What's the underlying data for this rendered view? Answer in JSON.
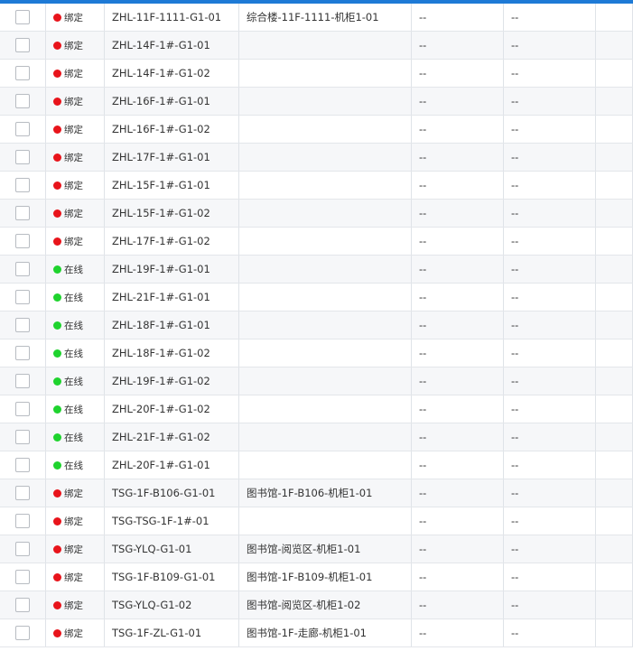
{
  "colors": {
    "bound": "#e8141b",
    "online": "#1fd32e",
    "accent": "#1e7ad6"
  },
  "rows": [
    {
      "status": "绑定",
      "state": "bound",
      "code": "ZHL-11F-1111-G1-01",
      "location": "综合楼-11F-1111-机柜1-01",
      "col_a": "--",
      "col_b": "--"
    },
    {
      "status": "绑定",
      "state": "bound",
      "code": "ZHL-14F-1#-G1-01",
      "location": "",
      "col_a": "--",
      "col_b": "--"
    },
    {
      "status": "绑定",
      "state": "bound",
      "code": "ZHL-14F-1#-G1-02",
      "location": "",
      "col_a": "--",
      "col_b": "--"
    },
    {
      "status": "绑定",
      "state": "bound",
      "code": "ZHL-16F-1#-G1-01",
      "location": "",
      "col_a": "--",
      "col_b": "--"
    },
    {
      "status": "绑定",
      "state": "bound",
      "code": "ZHL-16F-1#-G1-02",
      "location": "",
      "col_a": "--",
      "col_b": "--"
    },
    {
      "status": "绑定",
      "state": "bound",
      "code": "ZHL-17F-1#-G1-01",
      "location": "",
      "col_a": "--",
      "col_b": "--"
    },
    {
      "status": "绑定",
      "state": "bound",
      "code": "ZHL-15F-1#-G1-01",
      "location": "",
      "col_a": "--",
      "col_b": "--"
    },
    {
      "status": "绑定",
      "state": "bound",
      "code": "ZHL-15F-1#-G1-02",
      "location": "",
      "col_a": "--",
      "col_b": "--"
    },
    {
      "status": "绑定",
      "state": "bound",
      "code": "ZHL-17F-1#-G1-02",
      "location": "",
      "col_a": "--",
      "col_b": "--"
    },
    {
      "status": "在线",
      "state": "online",
      "code": "ZHL-19F-1#-G1-01",
      "location": "",
      "col_a": "--",
      "col_b": "--"
    },
    {
      "status": "在线",
      "state": "online",
      "code": "ZHL-21F-1#-G1-01",
      "location": "",
      "col_a": "--",
      "col_b": "--"
    },
    {
      "status": "在线",
      "state": "online",
      "code": "ZHL-18F-1#-G1-01",
      "location": "",
      "col_a": "--",
      "col_b": "--"
    },
    {
      "status": "在线",
      "state": "online",
      "code": "ZHL-18F-1#-G1-02",
      "location": "",
      "col_a": "--",
      "col_b": "--"
    },
    {
      "status": "在线",
      "state": "online",
      "code": "ZHL-19F-1#-G1-02",
      "location": "",
      "col_a": "--",
      "col_b": "--"
    },
    {
      "status": "在线",
      "state": "online",
      "code": "ZHL-20F-1#-G1-02",
      "location": "",
      "col_a": "--",
      "col_b": "--"
    },
    {
      "status": "在线",
      "state": "online",
      "code": "ZHL-21F-1#-G1-02",
      "location": "",
      "col_a": "--",
      "col_b": "--"
    },
    {
      "status": "在线",
      "state": "online",
      "code": "ZHL-20F-1#-G1-01",
      "location": "",
      "col_a": "--",
      "col_b": "--"
    },
    {
      "status": "绑定",
      "state": "bound",
      "code": "TSG-1F-B106-G1-01",
      "location": "图书馆-1F-B106-机柜1-01",
      "col_a": "--",
      "col_b": "--"
    },
    {
      "status": "绑定",
      "state": "bound",
      "code": "TSG-TSG-1F-1#-01",
      "location": "",
      "col_a": "--",
      "col_b": "--"
    },
    {
      "status": "绑定",
      "state": "bound",
      "code": "TSG-YLQ-G1-01",
      "location": "图书馆-阅览区-机柜1-01",
      "col_a": "--",
      "col_b": "--"
    },
    {
      "status": "绑定",
      "state": "bound",
      "code": "TSG-1F-B109-G1-01",
      "location": "图书馆-1F-B109-机柜1-01",
      "col_a": "--",
      "col_b": "--"
    },
    {
      "status": "绑定",
      "state": "bound",
      "code": "TSG-YLQ-G1-02",
      "location": "图书馆-阅览区-机柜1-02",
      "col_a": "--",
      "col_b": "--"
    },
    {
      "status": "绑定",
      "state": "bound",
      "code": "TSG-1F-ZL-G1-01",
      "location": "图书馆-1F-走廊-机柜1-01",
      "col_a": "--",
      "col_b": "--"
    }
  ]
}
